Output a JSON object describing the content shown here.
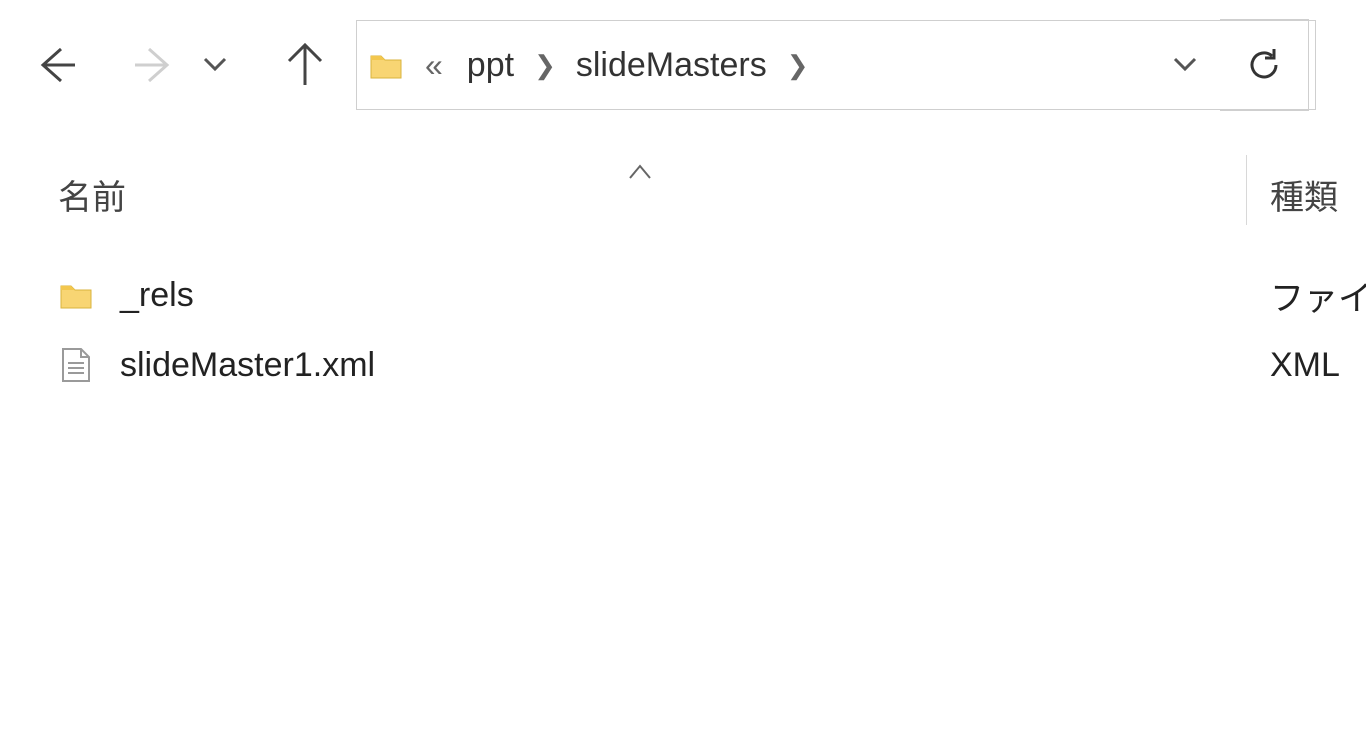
{
  "breadcrumb": {
    "items": [
      "ppt",
      "slideMasters"
    ]
  },
  "columns": {
    "name": "名前",
    "type": "種類"
  },
  "items": [
    {
      "name": "_rels",
      "type": "ファイル",
      "icon": "folder"
    },
    {
      "name": "slideMaster1.xml",
      "type": "XML",
      "icon": "xml"
    }
  ]
}
